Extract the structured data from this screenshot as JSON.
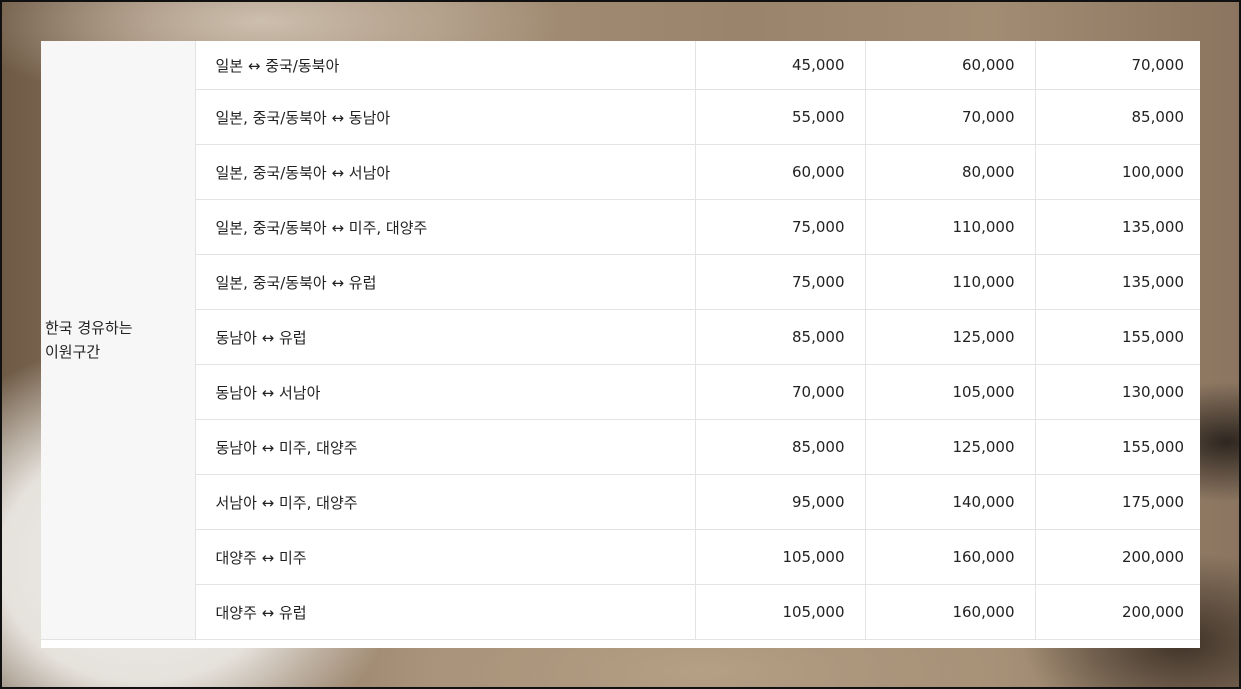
{
  "group_label": [
    "한국 경유하는",
    "이원구간"
  ],
  "rows": [
    {
      "route": "일본 ↔ 중국/동북아",
      "values": [
        "45,000",
        "60,000",
        "70,000"
      ]
    },
    {
      "route": "일본, 중국/동북아 ↔ 동남아",
      "values": [
        "55,000",
        "70,000",
        "85,000"
      ]
    },
    {
      "route": "일본, 중국/동북아 ↔ 서남아",
      "values": [
        "60,000",
        "80,000",
        "100,000"
      ]
    },
    {
      "route": "일본, 중국/동북아 ↔ 미주, 대양주",
      "values": [
        "75,000",
        "110,000",
        "135,000"
      ]
    },
    {
      "route": "일본, 중국/동북아 ↔ 유럽",
      "values": [
        "75,000",
        "110,000",
        "135,000"
      ]
    },
    {
      "route": "동남아 ↔ 유럽",
      "values": [
        "85,000",
        "125,000",
        "155,000"
      ]
    },
    {
      "route": "동남아 ↔ 서남아",
      "values": [
        "70,000",
        "105,000",
        "130,000"
      ]
    },
    {
      "route": "동남아 ↔ 미주, 대양주",
      "values": [
        "85,000",
        "125,000",
        "155,000"
      ]
    },
    {
      "route": "서남아 ↔ 미주, 대양주",
      "values": [
        "95,000",
        "140,000",
        "175,000"
      ]
    },
    {
      "route": "대양주 ↔ 미주",
      "values": [
        "105,000",
        "160,000",
        "200,000"
      ]
    },
    {
      "route": "대양주 ↔ 유럽",
      "values": [
        "105,000",
        "160,000",
        "200,000"
      ]
    }
  ]
}
